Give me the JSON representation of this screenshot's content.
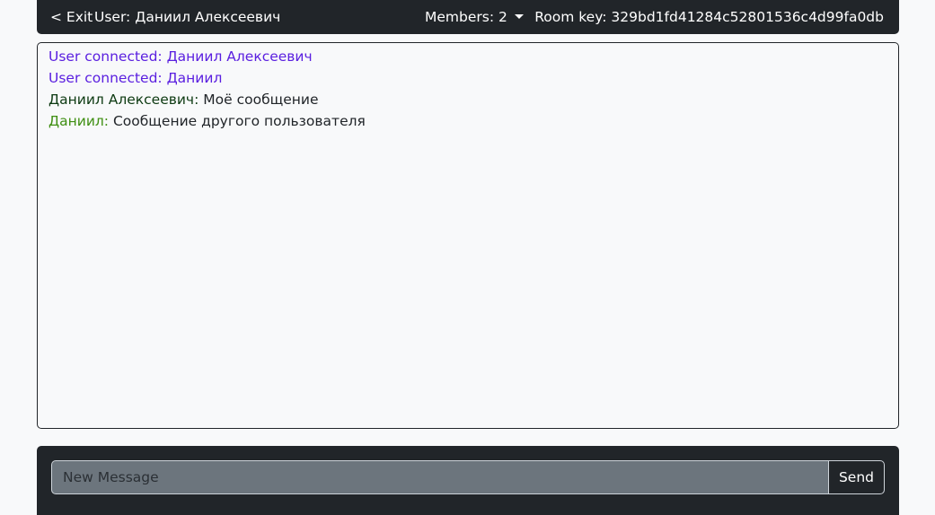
{
  "header": {
    "exit_label": "< Exit",
    "user_label": "User: Даниил Алексеевич",
    "members_label": "Members: 2",
    "room_key_label": "Room key: 329bd1fd41284c52801536c4d99fa0db"
  },
  "messages": [
    {
      "kind": "system",
      "text": "User connected: Даниил Алексеевич"
    },
    {
      "kind": "system",
      "text": "User connected: Даниил"
    },
    {
      "kind": "own",
      "author": "Даниил Алексеевич:",
      "text": " Моё сообщение"
    },
    {
      "kind": "other",
      "author": "Даниил:",
      "text": " Сообщение другого пользователя"
    }
  ],
  "composer": {
    "placeholder": "New Message",
    "value": "",
    "send_label": "Send"
  },
  "colors": {
    "bar_background": "#212529",
    "system_message": "#5a1fe0",
    "own_author": "#0d3a12",
    "other_author": "#3f8f12",
    "input_background": "#6c757d"
  },
  "icons": {
    "members_dropdown": "caret-down-icon"
  }
}
